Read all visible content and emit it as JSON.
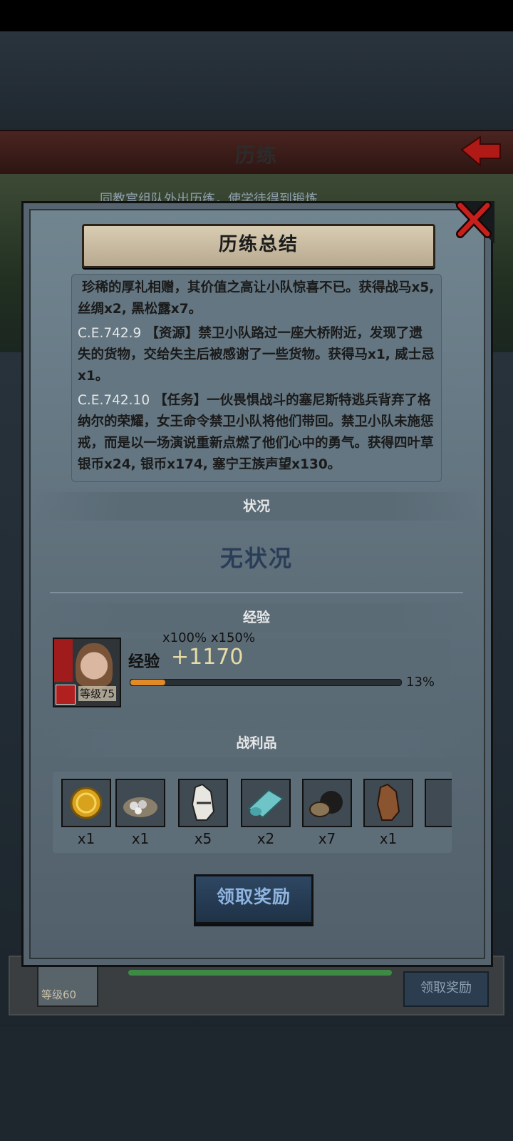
{
  "screen_title": "历练",
  "background": {
    "info_strip": "同教宫组队外出历练，使学徒得到锻炼",
    "level_label": "等级60",
    "claim_label": "领取奖励"
  },
  "dialog": {
    "title": "历练总结",
    "log": [
      {
        "date": "",
        "text": "珍稀的厚礼相赠，其价值之高让小队惊喜不已。获得战马x5, 丝绸x2, 黑松露x7。"
      },
      {
        "date": "C.E.742.9",
        "text": "【资源】禁卫小队路过一座大桥附近，发现了遗失的货物，交给失主后被感谢了一些货物。获得马x1, 威士忌x1。"
      },
      {
        "date": "C.E.742.10",
        "text": "【任务】一伙畏惧战斗的塞尼斯特逃兵背弃了格纳尔的荣耀，女王命令禁卫小队将他们带回。禁卫小队未施惩戒，而是以一场演说重新点燃了他们心中的勇气。获得四叶草银币x24, 银币x174, 塞宁王族声望x130。"
      }
    ],
    "status_header": "状况",
    "status_value": "无状况",
    "exp_header": "经验",
    "exp": {
      "level": "等级75",
      "multipliers": "x100%  x150%",
      "label": "经验",
      "value": "+1170",
      "percent_text": "13%",
      "progress": 0.13
    },
    "loot_header": "战利品",
    "loot": [
      {
        "icon": "gold-coin-icon",
        "qty": "x1"
      },
      {
        "icon": "ore-sack-icon",
        "qty": "x1"
      },
      {
        "icon": "warhorse-icon",
        "qty": "x5"
      },
      {
        "icon": "silk-icon",
        "qty": "x2"
      },
      {
        "icon": "truffle-icon",
        "qty": "x7"
      },
      {
        "icon": "horse-icon",
        "qty": "x1"
      }
    ],
    "claim_button": "领取奖励"
  }
}
